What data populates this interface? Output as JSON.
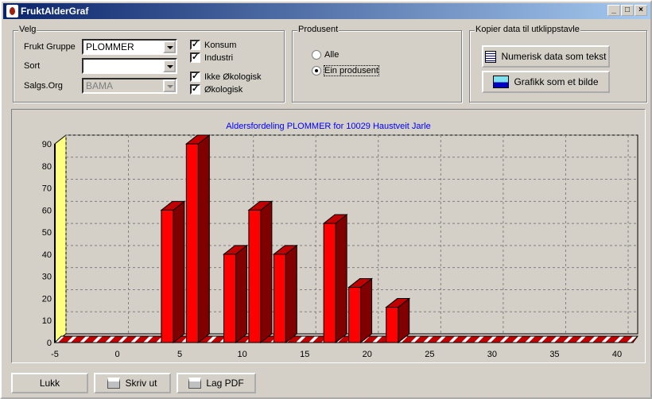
{
  "window": {
    "title": "FruktAlderGraf",
    "controls": [
      "_",
      "□",
      "×"
    ]
  },
  "velg": {
    "legend": "Velg",
    "frukt_gruppe": {
      "label": "Frukt Gruppe",
      "value": "PLOMMER"
    },
    "sort": {
      "label": "Sort",
      "value": ""
    },
    "salgs_org": {
      "label": "Salgs.Org",
      "value": "BAMA",
      "disabled": true
    },
    "checks": [
      {
        "label": "Konsum",
        "checked": true
      },
      {
        "label": "Industri",
        "checked": true
      },
      {
        "label": "Ikke Økologisk",
        "checked": true
      },
      {
        "label": "Økologisk",
        "checked": true
      }
    ]
  },
  "produsent": {
    "legend": "Produsent",
    "options": [
      {
        "label": "Alle",
        "selected": false
      },
      {
        "label": "Ein produsent",
        "selected": true
      }
    ]
  },
  "kopier": {
    "legend": "Kopier data til utklippstavle",
    "text_button": "Numerisk data som tekst",
    "image_button": "Grafikk som et bilde"
  },
  "buttons": {
    "close": "Lukk",
    "print": "Skriv ut",
    "pdf": "Lag PDF"
  },
  "chart_data": {
    "type": "bar",
    "title": "Aldersfordeling PLOMMER for 10029 Haustveit Jarle",
    "x": [
      4,
      6,
      9,
      11,
      13,
      17,
      19,
      22
    ],
    "values": [
      60,
      90,
      40,
      60,
      40,
      54,
      25,
      16
    ],
    "xlim": [
      -5,
      40
    ],
    "ylim": [
      0,
      90
    ],
    "xticks": [
      "-5",
      "0",
      "5",
      "10",
      "15",
      "20",
      "25",
      "30",
      "35",
      "40"
    ],
    "yticks": [
      "0",
      "10",
      "20",
      "30",
      "40",
      "50",
      "60",
      "70",
      "80",
      "90"
    ],
    "grid": true,
    "bar_color": "#ff0000",
    "title_color": "#0000ff",
    "wall_color": "#ffff80"
  }
}
